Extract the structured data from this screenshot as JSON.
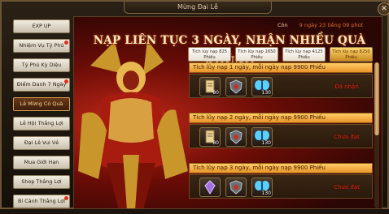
{
  "window": {
    "title": "Mừng Đại Lễ",
    "close_symbol": "✕"
  },
  "sidebar": {
    "items": [
      {
        "label": "EXP UP",
        "active": false,
        "dot": false
      },
      {
        "label": "Nhiệm Vụ Tỷ Phú",
        "active": false,
        "dot": true
      },
      {
        "label": "Tỷ Phú Kỳ Diệu",
        "active": false,
        "dot": false
      },
      {
        "label": "Điểm Danh 7 Ngày",
        "active": false,
        "dot": true
      },
      {
        "label": "Lễ Mừng Có Quà",
        "active": true,
        "dot": false
      },
      {
        "label": "Lễ Hội Thắng Lợi",
        "active": false,
        "dot": false
      },
      {
        "label": "Đại Lễ Vui Vẻ",
        "active": false,
        "dot": false
      },
      {
        "label": "Mua Giới Hạn",
        "active": false,
        "dot": false
      },
      {
        "label": "Shop Thắng Lợi",
        "active": false,
        "dot": false
      },
      {
        "label": "Bí Cảnh Thắng Lợi",
        "active": false,
        "dot": true
      }
    ]
  },
  "main": {
    "banner": "NẠP LIÊN TỤC 3 NGÀY, NHẬN NHIỀU QUÀ KHỦNG",
    "countdown_label": "Còn",
    "countdown_value": "9 ngày 23 tiếng 09 phút",
    "tabs": [
      {
        "line1": "Tích lũy nạp 825",
        "line2": "Phiếu",
        "active": false
      },
      {
        "line1": "Tích lũy nạp 1650",
        "line2": "Phiếu",
        "active": false
      },
      {
        "line1": "Tích lũy nạp 4125",
        "line2": "Phiếu",
        "active": false
      },
      {
        "line1": "Tích lũy nạp 8250",
        "line2": "Phiếu",
        "active": true
      }
    ],
    "rows": [
      {
        "header": "Tích lũy nạp 1 ngày,  mỗi ngày nạp 9900 Phiếu",
        "status": "Đã nhận",
        "items": [
          {
            "icon": "scroll-icon",
            "count": "80"
          },
          {
            "icon": "shield-icon",
            "count": ""
          },
          {
            "icon": "butterfly-icon",
            "count": "130"
          }
        ]
      },
      {
        "header": "Tích lũy nạp 2 ngày,  mỗi ngày nạp 9900 Phiếu",
        "status": "Chưa đạt",
        "items": [
          {
            "icon": "scroll-icon",
            "count": "80"
          },
          {
            "icon": "shield-icon",
            "count": ""
          },
          {
            "icon": "butterfly-icon",
            "count": "130"
          }
        ]
      },
      {
        "header": "Tích lũy nạp 3 ngày,  mỗi ngày nạp 9900 Phiếu",
        "status": "Chưa đạt",
        "items": [
          {
            "icon": "gem-icon",
            "count": ""
          },
          {
            "icon": "shield-icon",
            "count": ""
          },
          {
            "icon": "butterfly-icon",
            "count": "130"
          }
        ]
      }
    ]
  },
  "colors": {
    "accent_gold": "#e8942a",
    "status_red": "#e02810",
    "active_tab": "#ffd870"
  }
}
